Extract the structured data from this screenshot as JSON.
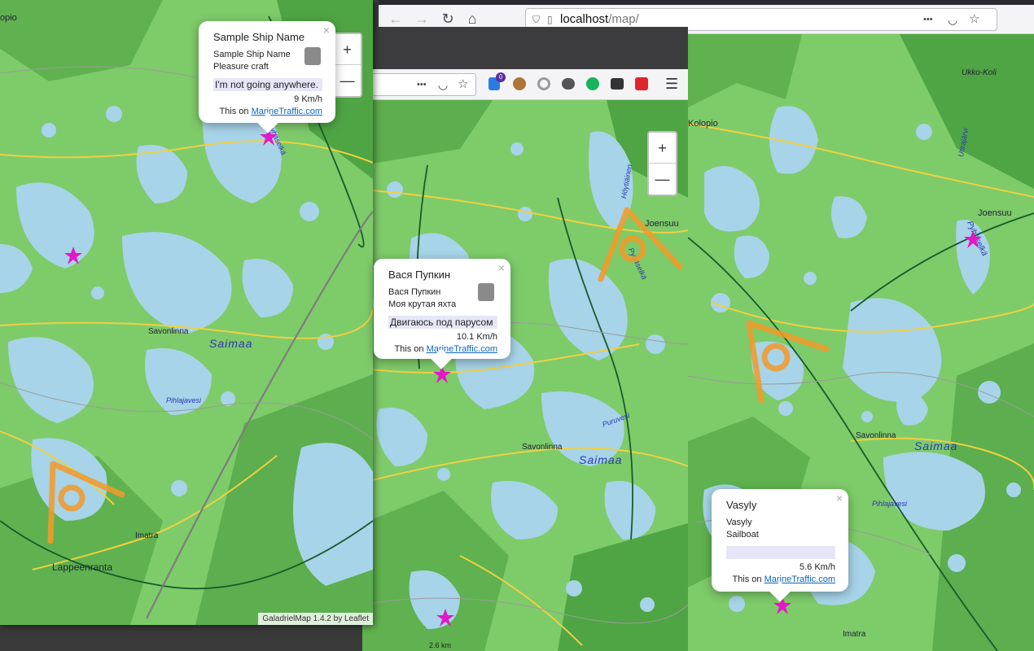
{
  "browser_right": {
    "url_host": "localhost",
    "url_path": "/map/",
    "nav": {
      "back": "←",
      "forward": "→",
      "reload": "↻",
      "home": "⌂"
    },
    "menu_dots": "•••"
  },
  "browser_middle": {
    "menu_dots": "•••",
    "hamburger": "☰",
    "ext_badge": "0"
  },
  "colors": {
    "water": "#a7d4e8",
    "land": "#7ecb6a",
    "road_main": "#f0d040",
    "marker": "#e418c8",
    "overlay": "#f49a2a"
  },
  "zoom": {
    "in": "+",
    "out": "—"
  },
  "map_left": {
    "places": {
      "savonlinna": "Savonlinna",
      "saimaa": "Saimaa",
      "pihlajavesi": "Pihlajavesi",
      "imatra": "Imatra",
      "lappeenranta": "Lappeenranta",
      "edge": "opio",
      "pyhaselka": "Pyhäselkä"
    },
    "attribution": "GaladrielMap 1.4.2 by Leaflet"
  },
  "map_middle": {
    "places": {
      "savonlinna": "Savonlinna",
      "saimaa": "Saimaa",
      "puruvesi": "Puruvesi",
      "joensuu": "Joensuu",
      "hoytiainen": "Höytiäinen",
      "pyhaselka": "Pyhäselkä"
    },
    "marker_label": "2.6 km"
  },
  "map_right": {
    "places": {
      "ukkokoli": "Ukko-Koli",
      "kolopio": "Kolopio",
      "joensuu": "Joensuu",
      "pyhaselka": "Pyhäselkä",
      "savonlinna": "Savonlinna",
      "saimaa": "Saimaa",
      "pihlajavesi": "Pihlajavesi",
      "imatra": "Imatra",
      "uttrajarvi": "Uttrajärvi"
    }
  },
  "popups": [
    {
      "name": "Sample Ship Name",
      "line1": "Sample Ship Name",
      "line2": "Pleasure craft",
      "status": "I'm not going anywhere.",
      "speed": "9 Km/h",
      "source_prefix": "This on ",
      "source_link": "MarineTraffic.com",
      "close": "×"
    },
    {
      "name": "Вася Пупкин",
      "line1": "Вася Пупкин",
      "line2": "Моя крутая яхта",
      "status": "Двигаюсь под парусом",
      "speed": "10.1 Km/h",
      "source_prefix": "This on ",
      "source_link": "MarineTraffic.com",
      "close": "×"
    },
    {
      "name": "Vasyly",
      "line1": "Vasyly",
      "line2": "Sailboat",
      "status": "",
      "speed": "5.6 Km/h",
      "source_prefix": "This on ",
      "source_link": "MarineTraffic.com",
      "close": "×"
    }
  ]
}
